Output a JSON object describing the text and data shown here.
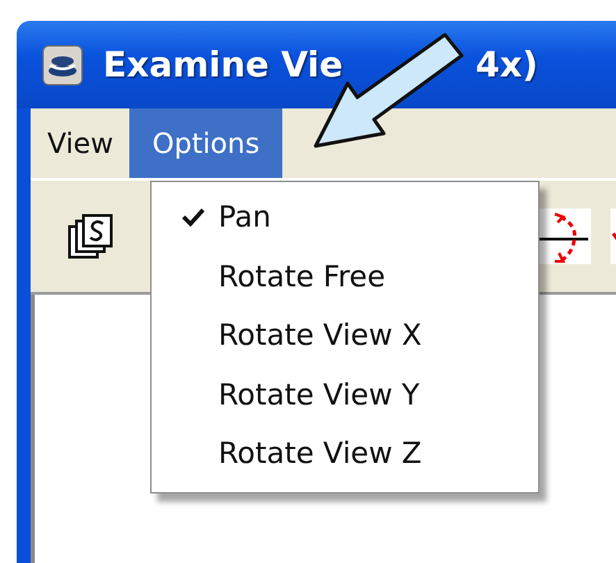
{
  "window": {
    "title": "Examine Vie",
    "title_tail": "4x)"
  },
  "menu_bar": [
    {
      "label": "View",
      "selected": false
    },
    {
      "label": "Options",
      "selected": true
    }
  ],
  "options_menu": {
    "items": [
      {
        "label": "Pan",
        "checked": true
      },
      {
        "label": "Rotate Free",
        "checked": false
      },
      {
        "label": "Rotate View X",
        "checked": false
      },
      {
        "label": "Rotate View Y",
        "checked": false
      },
      {
        "label": "Rotate View Z",
        "checked": false
      }
    ]
  }
}
